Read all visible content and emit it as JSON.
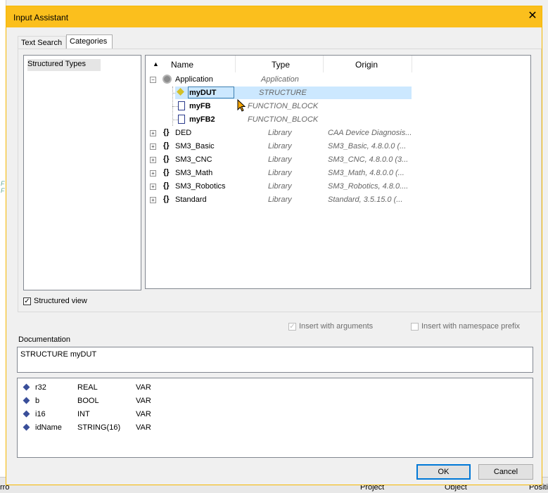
{
  "background": {
    "left_mark_1": "F",
    "left_mark_2": "F",
    "bottom_items": [
      "rro",
      "Project",
      "Object",
      "Positi"
    ]
  },
  "dialog": {
    "title": "Input Assistant",
    "close_glyph": "✕"
  },
  "tabs": [
    {
      "label": "Text Search",
      "active": false
    },
    {
      "label": "Categories",
      "active": true
    }
  ],
  "categories": {
    "items": [
      "Structured Types"
    ]
  },
  "tree": {
    "columns": {
      "name": "Name",
      "type": "Type",
      "origin": "Origin"
    },
    "sort_glyph": "▲",
    "rows": [
      {
        "name": "Application",
        "type": "Application",
        "origin": "",
        "expanded": true
      },
      {
        "name": "myDUT",
        "type": "STRUCTURE",
        "origin": "",
        "selected": true
      },
      {
        "name": "myFB",
        "type": "FUNCTION_BLOCK",
        "origin": ""
      },
      {
        "name": "myFB2",
        "type": "FUNCTION_BLOCK",
        "origin": ""
      },
      {
        "name": "DED",
        "type": "Library",
        "origin": "CAA Device Diagnosis..."
      },
      {
        "name": "SM3_Basic",
        "type": "Library",
        "origin": "SM3_Basic, 4.8.0.0 (..."
      },
      {
        "name": "SM3_CNC",
        "type": "Library",
        "origin": "SM3_CNC, 4.8.0.0 (3..."
      },
      {
        "name": "SM3_Math",
        "type": "Library",
        "origin": "SM3_Math, 4.8.0.0 (..."
      },
      {
        "name": "SM3_Robotics",
        "type": "Library",
        "origin": "SM3_Robotics, 4.8.0...."
      },
      {
        "name": "Standard",
        "type": "Library",
        "origin": "Standard, 3.5.15.0 (..."
      }
    ]
  },
  "options": {
    "structured_view": {
      "label": "Structured view",
      "checked": true
    },
    "insert_with_arguments": {
      "label": "Insert with arguments",
      "checked": true,
      "disabled": true
    },
    "insert_with_namespace_prefix": {
      "label": "Insert with namespace prefix",
      "checked": false,
      "disabled": true
    }
  },
  "documentation": {
    "label": "Documentation",
    "text": "STRUCTURE myDUT"
  },
  "variables": [
    {
      "name": "r32",
      "type": "REAL",
      "scope": "VAR"
    },
    {
      "name": "b",
      "type": "BOOL",
      "scope": "VAR"
    },
    {
      "name": "i16",
      "type": "INT",
      "scope": "VAR"
    },
    {
      "name": "idName",
      "type": "STRING(16)",
      "scope": "VAR"
    }
  ],
  "buttons": {
    "ok": "OK",
    "cancel": "Cancel"
  },
  "colors": {
    "title_bar": "#fbbf1d",
    "selection": "#cce8ff",
    "accent": "#0078d7"
  }
}
